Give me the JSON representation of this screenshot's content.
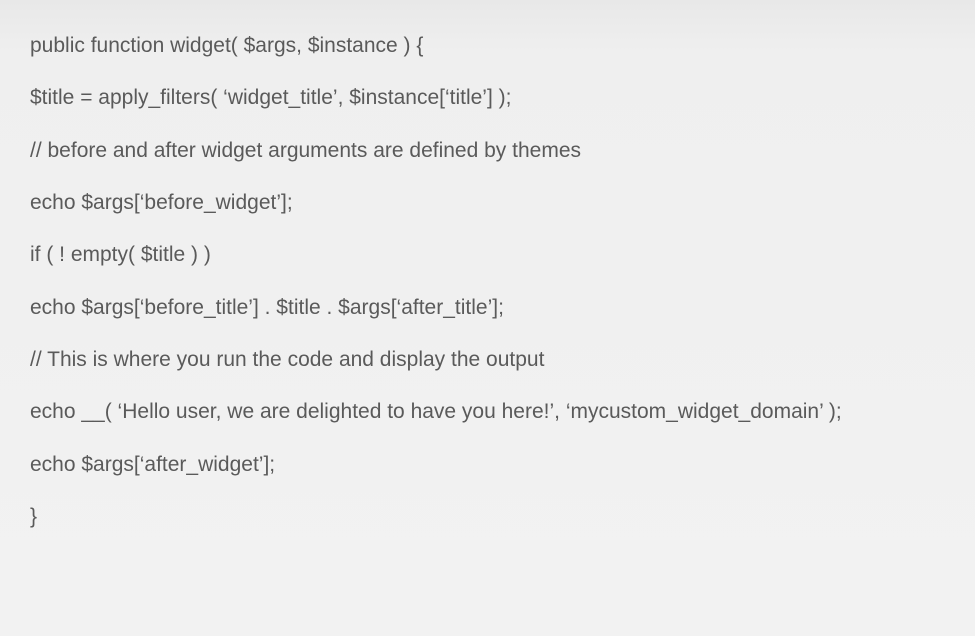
{
  "code": {
    "lines": [
      "public function widget( $args, $instance ) {",
      "$title = apply_filters( ‘widget_title’, $instance[‘title’] );",
      "// before and after widget arguments are defined by themes",
      "echo $args[‘before_widget’];",
      "if ( ! empty( $title ) )",
      "echo $args[‘before_title’] . $title . $args[‘after_title’];",
      "// This is where you run the code and display the output",
      "echo __( ‘Hello user, we are delighted to have you here!’, ‘mycustom_widget_domain’ );",
      "echo $args[‘after_widget’];",
      "}"
    ]
  }
}
